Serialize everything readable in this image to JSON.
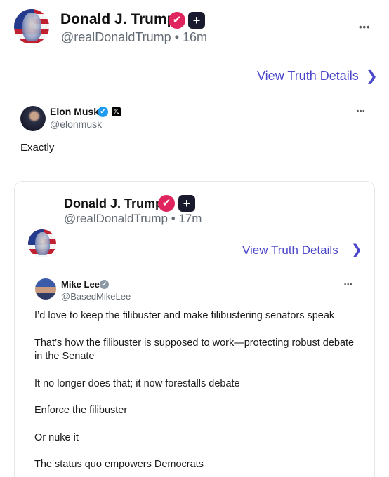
{
  "post": {
    "author_name": "Donald J. Trump",
    "author_handle": "@realDonaldTrump",
    "time": "16m",
    "verified_badge": "✔",
    "plus_badge": "+",
    "more_menu": "•••",
    "view_details": "View Truth Details",
    "chevron": "❯"
  },
  "elon_tweet": {
    "author_name": "Elon Musk",
    "author_handle": "@elonmusk",
    "verified_badge": "✔",
    "x_badge": "𝕏",
    "more_menu": "•••",
    "text": "Exactly"
  },
  "quoted_post": {
    "author_name": "Donald J. Trump",
    "author_handle": "@realDonaldTrump",
    "time": "17m",
    "verified_badge": "✔",
    "plus_badge": "+",
    "view_details": "View Truth Details",
    "chevron": "❯"
  },
  "mike_tweet": {
    "author_name": "Mike Lee",
    "author_handle": "@BasedMikeLee",
    "verified_badge": "✔",
    "more_menu": "•••",
    "lines": [
      "I’d love to keep the filibuster and make filibustering senators speak",
      "That’s how the filibuster is supposed to work—protecting robust debate",
      "in the Senate",
      "It no longer does that; it now forestalls debate",
      "Enforce the filibuster",
      "Or nuke it",
      "The status quo empowers Democrats"
    ]
  },
  "separator": "•",
  "colors": {
    "link": "#4b47c9",
    "badge_red": "#e0245e",
    "badge_blue": "#1d9bf0",
    "handle_grey": "#636b74"
  }
}
